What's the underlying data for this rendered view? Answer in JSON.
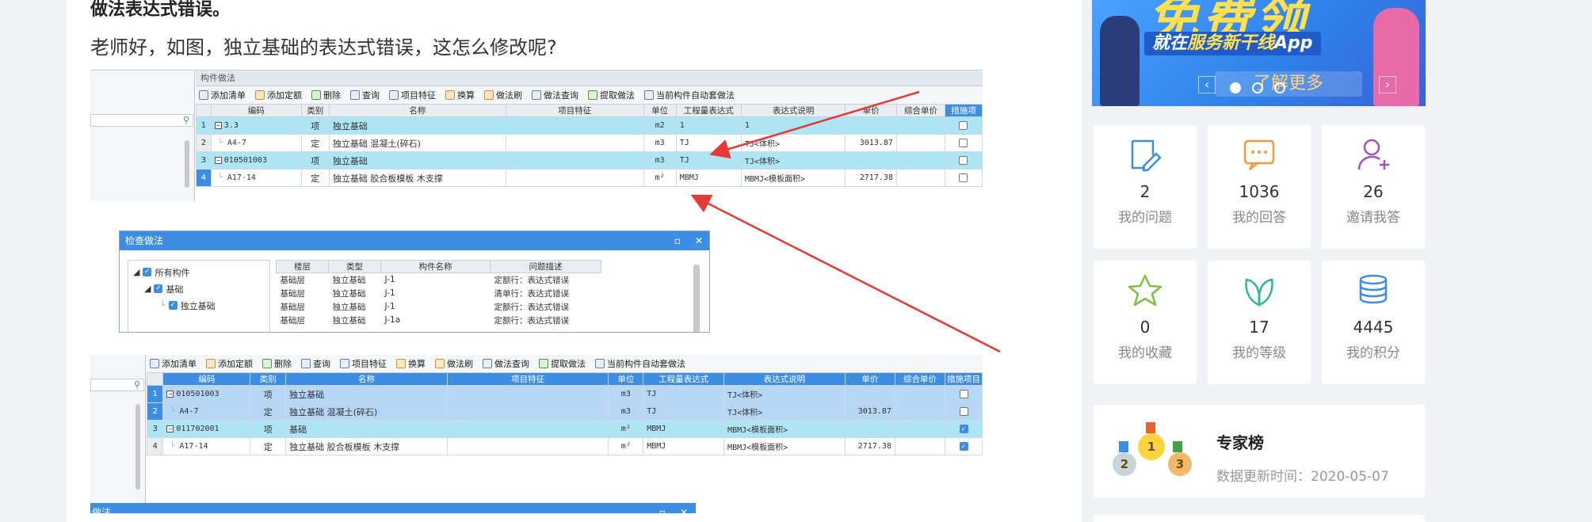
{
  "question": {
    "title": "做法表达式错误。",
    "body": "老师好，如图，独立基础的表达式错误，这怎么修改呢?"
  },
  "screenshot1": {
    "panel_title": "构件做法",
    "toolbar": [
      "添加清单",
      "添加定额",
      "删除",
      "查询",
      "项目特征",
      "换算",
      "做法刷",
      "做法查询",
      "提取做法",
      "当前构件自动套做法"
    ],
    "columns": [
      "编码",
      "类别",
      "名称",
      "项目特征",
      "单位",
      "工程量表达式",
      "表达式说明",
      "单价",
      "综合单价",
      "措施项"
    ],
    "rows": [
      {
        "n": "1",
        "code": "3.3",
        "type": "项",
        "name": "独立基础",
        "unit": "m2",
        "expr": "1",
        "desc": "1",
        "price": ""
      },
      {
        "n": "2",
        "code": "A4-7",
        "type": "定",
        "name": "独立基础 混凝土(碎石)",
        "unit": "m3",
        "expr": "TJ",
        "desc": "TJ<体积>",
        "price": "3013.87"
      },
      {
        "n": "3",
        "code": "010501003",
        "type": "项",
        "name": "独立基础",
        "unit": "m3",
        "expr": "TJ",
        "desc": "TJ<体积>",
        "price": ""
      },
      {
        "n": "4",
        "code": "A17-14",
        "type": "定",
        "name": "独立基础 胶合板模板 木支撑",
        "unit": "m²",
        "expr": "MBMJ",
        "desc": "MBMJ<模板面积>",
        "price": "2717.38"
      }
    ]
  },
  "check_dialog": {
    "title": "检查做法",
    "tree": [
      "所有构件",
      "基础",
      "独立基础"
    ],
    "columns": [
      "楼层",
      "类型",
      "构件名称",
      "问题描述"
    ],
    "rows": [
      {
        "floor": "基础层",
        "type": "独立基础",
        "name": "J-1",
        "issue": "定额行：表达式错误"
      },
      {
        "floor": "基础层",
        "type": "独立基础",
        "name": "J-1",
        "issue": "清单行：表达式错误"
      },
      {
        "floor": "基础层",
        "type": "独立基础",
        "name": "J-1",
        "issue": "定额行：表达式错误"
      },
      {
        "floor": "基础层",
        "type": "独立基础",
        "name": "J-1a",
        "issue": "定额行：表达式错误"
      }
    ]
  },
  "screenshot2": {
    "toolbar": [
      "添加清单",
      "添加定额",
      "删除",
      "查询",
      "项目特征",
      "换算",
      "做法刷",
      "做法查询",
      "提取做法",
      "当前构件自动套做法"
    ],
    "columns": [
      "编码",
      "类别",
      "名称",
      "项目特征",
      "单位",
      "工程量表达式",
      "表达式说明",
      "单价",
      "综合单价",
      "措施项目"
    ],
    "rows": [
      {
        "n": "1",
        "code": "010501003",
        "type": "项",
        "name": "独立基础",
        "unit": "m3",
        "expr": "TJ",
        "desc": "TJ<体积>",
        "price": "",
        "checked": false
      },
      {
        "n": "2",
        "code": "A4-7",
        "type": "定",
        "name": "独立基础 混凝土(碎石)",
        "unit": "m3",
        "expr": "TJ",
        "desc": "TJ<体积>",
        "price": "3013.87",
        "checked": false
      },
      {
        "n": "3",
        "code": "011702001",
        "type": "项",
        "name": "基础",
        "unit": "m²",
        "expr": "MBMJ",
        "desc": "MBMJ<模板面积>",
        "price": "",
        "checked": true
      },
      {
        "n": "4",
        "code": "A17-14",
        "type": "定",
        "name": "独立基础 胶合板模板 木支撑",
        "unit": "m²",
        "expr": "MBMJ",
        "desc": "MBMJ<模板面积>",
        "price": "2717.38",
        "checked": true
      }
    ],
    "dialog_title": "做法"
  },
  "banner": {
    "headline": "免费领",
    "subline_prefix": "就在",
    "subline_highlight": "服务新干线",
    "subline_suffix": "App",
    "more": "了解更多"
  },
  "stats": [
    {
      "num": "2",
      "label": "我的问题",
      "icon": "edit-icon",
      "color": "#3d8ee3"
    },
    {
      "num": "1036",
      "label": "我的回答",
      "icon": "chat-icon",
      "color": "#f39c3d"
    },
    {
      "num": "26",
      "label": "邀请我答",
      "icon": "user-plus-icon",
      "color": "#a24fc4"
    },
    {
      "num": "0",
      "label": "我的收藏",
      "icon": "star-icon",
      "color": "#7cc142"
    },
    {
      "num": "17",
      "label": "我的等级",
      "icon": "leaf-icon",
      "color": "#2fb896"
    },
    {
      "num": "4445",
      "label": "我的积分",
      "icon": "coins-icon",
      "color": "#3d8ee3"
    }
  ],
  "expert": {
    "title": "专家榜",
    "date": "数据更新时间：2020-05-07"
  }
}
